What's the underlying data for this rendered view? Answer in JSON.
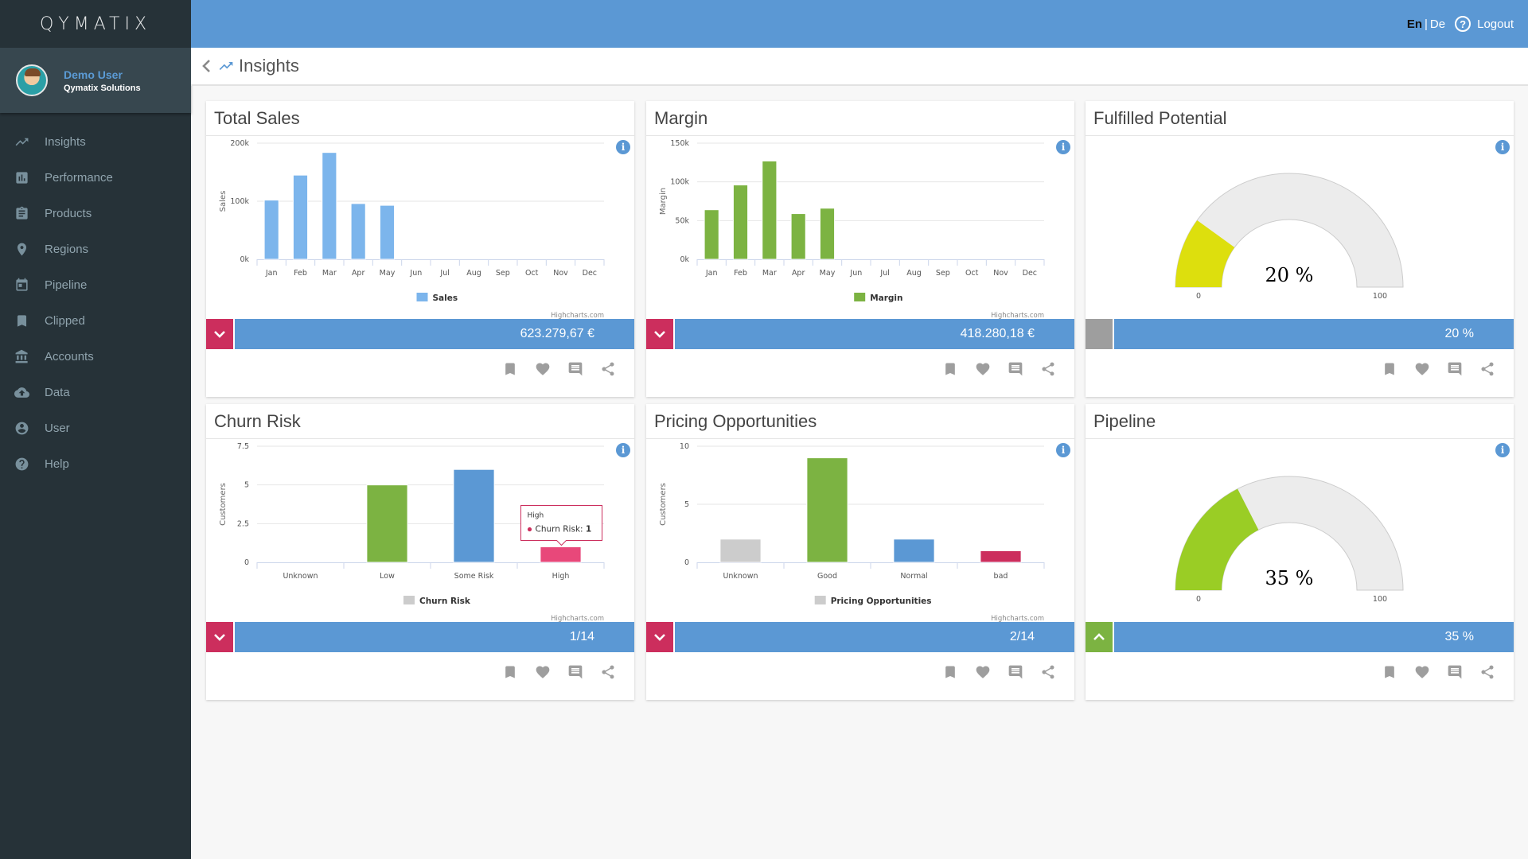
{
  "app": {
    "logo": "QYMATIX",
    "user_name": "Demo User",
    "user_org": "Qymatix Solutions"
  },
  "sidebar": {
    "items": [
      {
        "label": "Insights",
        "icon": "trending-up-icon"
      },
      {
        "label": "Performance",
        "icon": "bar-chart-icon"
      },
      {
        "label": "Products",
        "icon": "clipboard-icon"
      },
      {
        "label": "Regions",
        "icon": "map-pin-icon"
      },
      {
        "label": "Pipeline",
        "icon": "calendar-icon"
      },
      {
        "label": "Clipped",
        "icon": "bookmark-icon"
      },
      {
        "label": "Accounts",
        "icon": "bank-icon"
      },
      {
        "label": "Data",
        "icon": "cloud-upload-icon"
      },
      {
        "label": "User",
        "icon": "account-circle-icon"
      },
      {
        "label": "Help",
        "icon": "help-circle-icon"
      }
    ]
  },
  "header": {
    "lang_en": "En",
    "lang_sep": "|",
    "lang_de": "De",
    "help_glyph": "?",
    "logout": "Logout"
  },
  "subheader": {
    "title": "Insights"
  },
  "colors": {
    "accent": "#5b98d4",
    "sidebar_bg": "#263238",
    "down": "#cc2e5d",
    "up": "#7cb342",
    "neutral": "#9e9e9e"
  },
  "cards": [
    {
      "title": "Total Sales",
      "kpi": "623.279,67 €",
      "trend": "down"
    },
    {
      "title": "Margin",
      "kpi": "418.280,18 €",
      "trend": "down"
    },
    {
      "title": "Fulfilled Potential",
      "kpi": "20 %",
      "trend": "neutral"
    },
    {
      "title": "Churn Risk",
      "kpi": "1/14",
      "trend": "down"
    },
    {
      "title": "Pricing Opportunities",
      "kpi": "2/14",
      "trend": "down"
    },
    {
      "title": "Pipeline",
      "kpi": "35 %",
      "trend": "up"
    }
  ],
  "chart_data": [
    {
      "type": "bar",
      "title": "Total Sales",
      "categories": [
        "Jan",
        "Feb",
        "Mar",
        "Apr",
        "May",
        "Jun",
        "Jul",
        "Aug",
        "Sep",
        "Oct",
        "Nov",
        "Dec"
      ],
      "series": [
        {
          "name": "Sales",
          "color": "#7cb5ec",
          "values": [
            102000,
            145000,
            184000,
            96000,
            93000,
            0,
            0,
            0,
            0,
            0,
            0,
            0
          ]
        }
      ],
      "ylabel": "Sales",
      "yticks": [
        "0k",
        "100k",
        "200k"
      ],
      "ylim": [
        0,
        200000
      ],
      "legend": "bottom-center",
      "credit": "Highcharts.com",
      "info": "i"
    },
    {
      "type": "bar",
      "title": "Margin",
      "categories": [
        "Jan",
        "Feb",
        "Mar",
        "Apr",
        "May",
        "Jun",
        "Jul",
        "Aug",
        "Sep",
        "Oct",
        "Nov",
        "Dec"
      ],
      "series": [
        {
          "name": "Margin",
          "color": "#7cb342",
          "values": [
            64000,
            96000,
            127000,
            59000,
            66000,
            0,
            0,
            0,
            0,
            0,
            0,
            0
          ]
        }
      ],
      "ylabel": "Margin",
      "yticks": [
        "0k",
        "50k",
        "100k",
        "150k"
      ],
      "ylim": [
        0,
        150000
      ],
      "legend": "bottom-center",
      "credit": "Highcharts.com",
      "info": "i"
    },
    {
      "type": "gauge",
      "title": "Fulfilled Potential",
      "value": 20,
      "label": "20 %",
      "min": 0,
      "max": 100,
      "min_label": "0",
      "max_label": "100",
      "color": "#dddf0d",
      "info": "i"
    },
    {
      "type": "bar",
      "title": "Churn Risk",
      "categories": [
        "Unknown",
        "Low",
        "Some Risk",
        "High"
      ],
      "series": [
        {
          "name": "Churn Risk",
          "values": [
            0,
            5,
            6,
            1
          ],
          "colors": [
            "#cccccc",
            "#7cb342",
            "#5b98d4",
            "#e8487a"
          ]
        }
      ],
      "ylabel": "Customers",
      "yticks": [
        "0",
        "2.5",
        "5",
        "7.5"
      ],
      "ylim": [
        0,
        7.5
      ],
      "legend": "bottom-center",
      "legend_color": "#cccccc",
      "credit": "Highcharts.com",
      "tooltip": {
        "category": "High",
        "series": "Churn Risk",
        "value": "1",
        "label": "Churn Risk: ",
        "color": "#cc2e5d"
      },
      "info": "i"
    },
    {
      "type": "bar",
      "title": "Pricing Opportunities",
      "categories": [
        "Unknown",
        "Good",
        "Normal",
        "bad"
      ],
      "series": [
        {
          "name": "Pricing Opportunities",
          "values": [
            2,
            9,
            2,
            1
          ],
          "colors": [
            "#cccccc",
            "#7cb342",
            "#5b98d4",
            "#cc2e5d"
          ]
        }
      ],
      "ylabel": "Customers",
      "yticks": [
        "0",
        "5",
        "10"
      ],
      "ylim": [
        0,
        10
      ],
      "legend": "bottom-center",
      "legend_color": "#cccccc",
      "credit": "Highcharts.com",
      "info": "i"
    },
    {
      "type": "gauge",
      "title": "Pipeline",
      "value": 35,
      "label": "35 %",
      "min": 0,
      "max": 100,
      "min_label": "0",
      "max_label": "100",
      "color": "#9acd25",
      "info": "i"
    }
  ]
}
